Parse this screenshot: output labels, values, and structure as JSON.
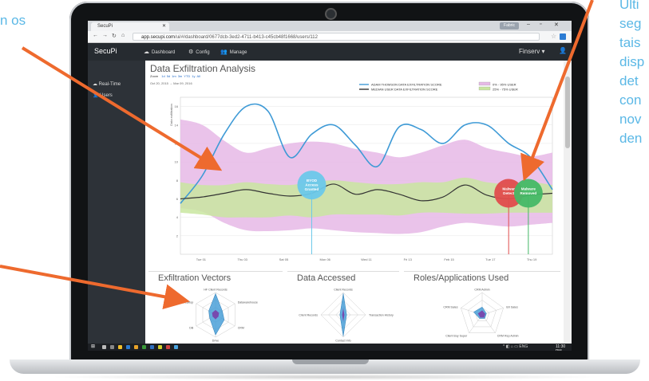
{
  "annotations": {
    "left_text": "n os",
    "right_lines": [
      "Ulti",
      "seg",
      "tais",
      "disp",
      "det",
      "con",
      "nov",
      "den"
    ],
    "arrow_color": "#ee6a2e",
    "text_color": "#5bb8e6"
  },
  "browser": {
    "tab_title": "SecuPi",
    "profile_label": "Fabric",
    "url_host": "app.secupi.com",
    "url_path": "/ui/#/dashboard/0677dcb-3ed2-4711-b413-c45cb48f1668/users/112"
  },
  "app": {
    "brand": "SecuPi",
    "nav": [
      {
        "icon": "cloud-icon",
        "label": "Dashboard"
      },
      {
        "icon": "gear-icon",
        "label": "Config"
      },
      {
        "icon": "users-icon",
        "label": "Manage"
      }
    ],
    "tenant": "Finserv",
    "sidebar": [
      {
        "icon": "cloud-icon",
        "label": "Real-Time"
      },
      {
        "icon": "user-icon",
        "label": "Users"
      }
    ]
  },
  "analysis": {
    "title": "Data Exfiltration Analysis",
    "zoom_label": "Zoom",
    "zoom_options": [
      "1d",
      "5d",
      "1m",
      "3m",
      "YTD",
      "1y",
      "All"
    ],
    "date_range": "Oct 20, 2015 → Mar 09, 2016"
  },
  "chart_data": {
    "type": "line",
    "ylabel": "Data exfiltration",
    "x_ticks": [
      "Tue 01",
      "Thu 03",
      "Sat 05",
      "Mon 06",
      "Wed 11",
      "Fri 13",
      "Feb 15",
      "Tue 17",
      "Thu 19"
    ],
    "y_ticks": [
      2,
      4,
      6,
      8,
      10,
      12,
      14,
      16
    ],
    "ylim": [
      0,
      17
    ],
    "grid": true,
    "legend_position": "top-right",
    "x_positions": [
      0,
      1,
      2,
      3,
      4,
      5,
      6,
      7,
      8,
      9,
      10,
      11,
      12,
      13,
      14,
      15,
      16,
      17
    ],
    "series": [
      {
        "name": "ADAM THOMSON DATA EXFILTRATION SCORE",
        "color": "#3e9ad6",
        "values": [
          5.5,
          8.5,
          13,
          16,
          15.5,
          10.5,
          13,
          14,
          11.8,
          9.5,
          13.8,
          13.5,
          12,
          14,
          14,
          12,
          10.5,
          7
        ]
      },
      {
        "name": "MEDIAN USER DATA EXFILTRATION SCORE",
        "color": "#333333",
        "values": [
          6,
          6.2,
          6.6,
          7,
          6.6,
          6.3,
          6.6,
          7.6,
          6.5,
          7,
          6.5,
          5.8,
          6.2,
          7.5,
          6.4,
          6,
          6.4,
          6.6
        ]
      }
    ],
    "bands": [
      {
        "name": "0% - 95% USER",
        "color": "#e6b9e6",
        "upper": [
          14.6,
          14,
          12.3,
          11,
          11.5,
          12,
          12.2,
          12,
          11.4,
          11,
          10.5,
          11,
          11.8,
          12.4,
          11.5,
          11,
          10.6,
          11
        ],
        "lower": [
          5,
          4.6,
          3.4,
          2.6,
          2.5,
          2.6,
          2.8,
          2.6,
          2.4,
          2.3,
          2.2,
          2.4,
          3,
          3.4,
          3.2,
          3,
          3.2,
          3.4
        ]
      },
      {
        "name": "25% - 75% USER",
        "color": "#c9e6a0",
        "upper": [
          7.8,
          7.5,
          7.5,
          7.8,
          7.6,
          7.5,
          7.8,
          8,
          7.8,
          7.6,
          7.6,
          7.8,
          7.8,
          8.3,
          7.8,
          7.6,
          7.8,
          7.5
        ],
        "lower": [
          4.5,
          4.3,
          4,
          4,
          4,
          4.2,
          4,
          4.3,
          4.3,
          4.3,
          4.2,
          4.5,
          4.5,
          4.4,
          4.4,
          4.5,
          4.5,
          4.5
        ]
      }
    ],
    "events": [
      {
        "label": "BYOD Access Granted",
        "lines": [
          "BYOD",
          "Access",
          "Granted"
        ],
        "x": 6,
        "y": 7.5,
        "color": "#6cc8ea"
      },
      {
        "label": "Malware Detect",
        "lines": [
          "Malwar",
          "Detect"
        ],
        "x": 15,
        "y": 6.6,
        "color": "#e04c4c"
      },
      {
        "label": "Malware Removed",
        "lines": [
          "Malware",
          "Removed"
        ],
        "x": 15.9,
        "y": 6.6,
        "color": "#44b866"
      }
    ]
  },
  "panels": [
    {
      "title": "Exfiltration Vectors",
      "axes": [
        "HF Client Records",
        "Datawarehouse",
        "CRM",
        "Drive",
        "DB",
        "Desktop"
      ],
      "user": [
        0.95,
        0.35,
        0.45,
        0.9,
        0.3,
        0.35
      ],
      "median": [
        0.22,
        0.18,
        0.15,
        0.2,
        0.15,
        0.18
      ]
    },
    {
      "title": "Data Accessed",
      "axes": [
        "Client Records",
        "Transaction History",
        "Contact Info",
        "Client Records"
      ],
      "user": [
        0.95,
        0.15,
        0.95,
        0.15
      ],
      "median": [
        0.3,
        0.05,
        0.3,
        0.05
      ]
    },
    {
      "title": "Roles/Applications Used",
      "axes": [
        "CRM Admin",
        "B/I Sales",
        "CRM Rep Admin",
        "Client Buy Super",
        "CRM Sales"
      ],
      "user": [
        0.35,
        0.2,
        0.2,
        0.2,
        0.4
      ],
      "median": [
        0.2,
        0.15,
        0.15,
        0.15,
        0.2
      ]
    }
  ],
  "os": {
    "time": "11:30 PM",
    "tray_lang": "ENG"
  }
}
